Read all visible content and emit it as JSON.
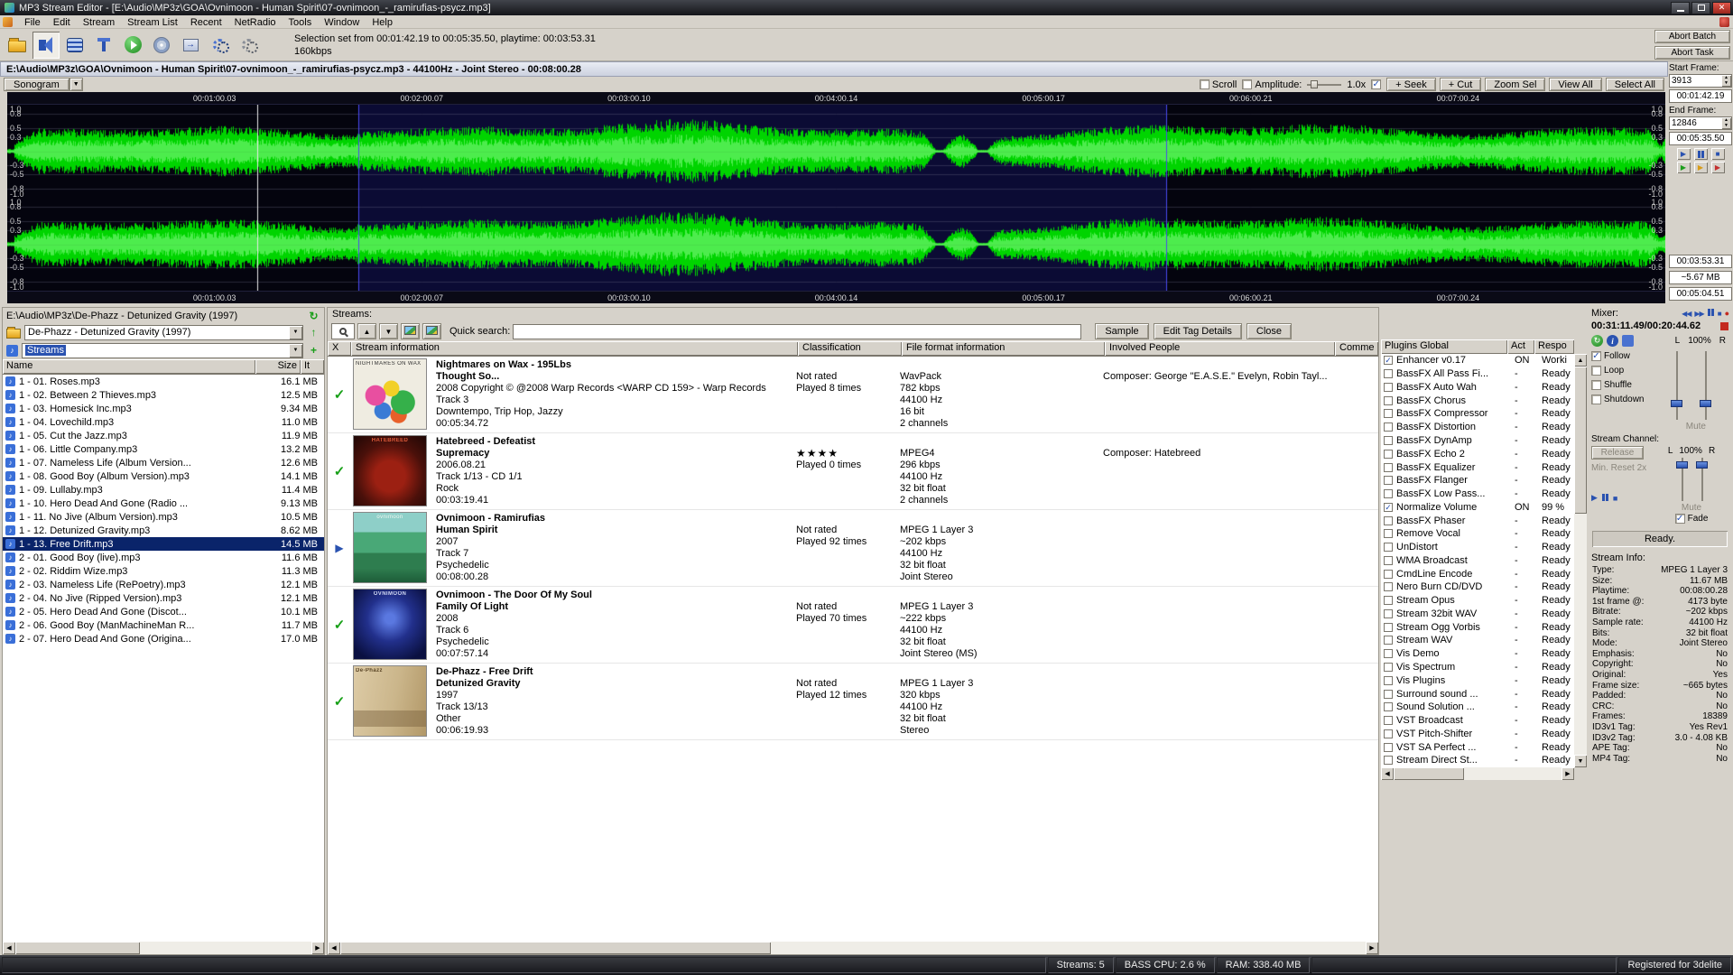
{
  "titlebar": {
    "title": "MP3 Stream Editor - [E:\\Audio\\MP3z\\GOA\\Ovnimoon - Human Spirit\\07-ovnimoon_-_ramirufias-psycz.mp3]"
  },
  "menu": {
    "items": [
      "File",
      "Edit",
      "Stream",
      "Stream List",
      "Recent",
      "NetRadio",
      "Tools",
      "Window",
      "Help"
    ]
  },
  "toolbar": {
    "icons": [
      {
        "id": "open-file"
      },
      {
        "id": "speaker",
        "pressed": true
      },
      {
        "id": "stream-stack"
      },
      {
        "id": "audio-jack"
      },
      {
        "id": "play-green"
      },
      {
        "id": "cd"
      },
      {
        "id": "encode",
        "glyph": "→"
      },
      {
        "id": "gears"
      },
      {
        "id": "settings"
      }
    ],
    "status_line1": "Selection set from 00:01:42.19 to 00:05:35.50, playtime: 00:03:53.31",
    "status_line2": "160kbps",
    "abort_batch": "Abort Batch",
    "abort_task": "Abort Task"
  },
  "wave": {
    "header": "E:\\Audio\\MP3z\\GOA\\Ovnimoon - Human Spirit\\07-ovnimoon_-_ramirufias-psycz.mp3 - 44100Hz - Joint Stereo - 00:08:00.28",
    "sonogram": "Sonogram",
    "scroll": "Scroll",
    "amplitude": "Amplitude:",
    "zoom": "1.0x",
    "buttons": [
      "+ Seek",
      "+ Cut",
      "Zoom Sel",
      "View All",
      "Select All"
    ],
    "time_markers": [
      "00:01:00.03",
      "00:02:00.07",
      "00:03:00.10",
      "00:04:00.14",
      "00:05:00.17",
      "00:06:00.21",
      "00:07:00.24"
    ],
    "amp_labels": [
      1.0,
      0.8,
      0.5,
      0.3,
      -0.3,
      -0.5,
      -0.8,
      -1.0
    ],
    "selection_start": 0.212,
    "selection_end": 0.699,
    "cursor": 0.151,
    "wave_color": "#00d400",
    "bg_color": "#04040e",
    "selection_color": "#0b0b34"
  },
  "frame_panel": {
    "start_frame_label": "Start Frame:",
    "start_frame": "3913",
    "start_time": "00:01:42.19",
    "end_frame_label": "End Frame:",
    "end_frame": "12846",
    "end_time": "00:05:35.50",
    "transport1": [
      {
        "name": "play",
        "glyph": "▶",
        "color": "#2a52b0"
      },
      {
        "name": "pause",
        "glyph": "bars",
        "color": "#2a52b0"
      },
      {
        "name": "stop",
        "glyph": "■",
        "color": "#2a52b0"
      }
    ],
    "transport2": [
      {
        "name": "play-green",
        "glyph": "▶",
        "color": "#1d9e1d"
      },
      {
        "name": "play-yellow",
        "glyph": "▶",
        "color": "#d89c18"
      },
      {
        "name": "play-red",
        "glyph": "▶",
        "color": "#c43030"
      }
    ],
    "sel_playtime": "00:03:53.31",
    "sel_size": "~5.67 MB",
    "total_time": "00:05:04.51"
  },
  "browser": {
    "path": "E:\\Audio\\MP3z\\De-Phazz - Detunized Gravity (1997)",
    "folder_combo": "De-Phazz - Detunized Gravity (1997)",
    "streams_combo": "Streams",
    "columns": [
      "Name",
      "Size",
      "It"
    ],
    "selected_index": 12,
    "files": [
      {
        "name": "1 - 01. Roses.mp3",
        "size": "16.1 MB"
      },
      {
        "name": "1 - 02. Between 2 Thieves.mp3",
        "size": "12.5 MB"
      },
      {
        "name": "1 - 03. Homesick Inc.mp3",
        "size": "9.34 MB"
      },
      {
        "name": "1 - 04. Lovechild.mp3",
        "size": "11.0 MB"
      },
      {
        "name": "1 - 05. Cut the Jazz.mp3",
        "size": "11.9 MB"
      },
      {
        "name": "1 - 06. Little Company.mp3",
        "size": "13.2 MB"
      },
      {
        "name": "1 - 07. Nameless Life (Album Version...",
        "size": "12.6 MB"
      },
      {
        "name": "1 - 08. Good Boy (Album Version).mp3",
        "size": "14.1 MB"
      },
      {
        "name": "1 - 09. Lullaby.mp3",
        "size": "11.4 MB"
      },
      {
        "name": "1 - 10. Hero Dead And Gone (Radio ...",
        "size": "9.13 MB"
      },
      {
        "name": "1 - 11. No Jive (Album Version).mp3",
        "size": "10.5 MB"
      },
      {
        "name": "1 - 12. Detunized Gravity.mp3",
        "size": "8.62 MB"
      },
      {
        "name": "1 - 13. Free Drift.mp3",
        "size": "14.5 MB"
      },
      {
        "name": "2 - 01. Good Boy (live).mp3",
        "size": "11.6 MB"
      },
      {
        "name": "2 - 02. Riddim Wize.mp3",
        "size": "11.3 MB"
      },
      {
        "name": "2 - 03. Nameless Life (RePoetry).mp3",
        "size": "12.1 MB"
      },
      {
        "name": "2 - 04. No Jive (Ripped Version).mp3",
        "size": "12.1 MB"
      },
      {
        "name": "2 - 05. Hero Dead And Gone (Discot...",
        "size": "10.1 MB"
      },
      {
        "name": "2 - 06. Good Boy (ManMachineMan R...",
        "size": "11.7 MB"
      },
      {
        "name": "2 - 07. Hero Dead And Gone (Origina...",
        "size": "17.0 MB"
      }
    ]
  },
  "streams": {
    "title": "Streams:",
    "quick_search_label": "Quick search:",
    "search_value": "",
    "buttons": [
      "Sample",
      "Edit Tag Details",
      "Close"
    ],
    "columns": [
      "X",
      "Stream information",
      "Classification",
      "File format information",
      "Involved People",
      "Comme"
    ],
    "rows": [
      {
        "status": "check",
        "art": "art-now",
        "art_label": "NIGHTMARES ON WAX",
        "title": "Nightmares on Wax - 195Lbs",
        "album": "Thought So...",
        "line3": "2008 Copyright © @2008 Warp Records <WARP CD 159> - Warp Records",
        "line4": "Track 3",
        "line5": "Downtempo, Trip Hop, Jazzy",
        "line6": "00:05:34.72",
        "rating": "Not rated",
        "played": "Played 8 times",
        "format": [
          "WavPack",
          "782 kbps",
          "44100 Hz",
          "16 bit",
          "2 channels"
        ],
        "involved": "Composer: George \"E.A.S.E.\" Evelyn, Robin Tayl..."
      },
      {
        "status": "check",
        "art": "art-hatebreed",
        "art_label": "HATEBREED",
        "title": "Hatebreed - Defeatist",
        "album": "Supremacy",
        "line3": "2006.08.21",
        "line4": "Track 1/13 - CD 1/1",
        "line5": "Rock",
        "line6": "00:03:19.41",
        "rating": "★★★★",
        "played": "Played 0 times",
        "format": [
          "MPEG4",
          "296 kbps",
          "44100 Hz",
          "32 bit float",
          "2 channels"
        ],
        "involved": "Composer: Hatebreed"
      },
      {
        "status": "play",
        "art": "art-ovnimoon1",
        "art_label": "ovnimoon",
        "title": "Ovnimoon - Ramirufias",
        "album": "Human Spirit",
        "line3": "2007",
        "line4": "Track 7",
        "line5": "Psychedelic",
        "line6": "00:08:00.28",
        "rating": "Not rated",
        "played": "Played 92 times",
        "format": [
          "MPEG 1 Layer 3",
          "~202 kbps",
          "44100 Hz",
          "32 bit float",
          "Joint Stereo"
        ],
        "involved": ""
      },
      {
        "status": "check",
        "art": "art-ovnimoon2",
        "art_label": "OVNIMOON",
        "title": "Ovnimoon - The Door Of My Soul",
        "album": "Family Of Light",
        "line3": "2008",
        "line4": "Track 6",
        "line5": "Psychedelic",
        "line6": "00:07:57.14",
        "rating": "Not rated",
        "played": "Played 70 times",
        "format": [
          "MPEG 1 Layer 3",
          "~222 kbps",
          "44100 Hz",
          "32 bit float",
          "Joint Stereo (MS)"
        ],
        "involved": ""
      },
      {
        "status": "check",
        "art": "art-dephazz",
        "art_label": "De-Phazz",
        "title": "De-Phazz - Free Drift",
        "album": "Detunized Gravity",
        "line3": "1997",
        "line4": "Track 13/13",
        "line5": "Other",
        "line6": "00:06:19.93",
        "rating": "Not rated",
        "played": "Played 12 times",
        "format": [
          "MPEG 1 Layer 3",
          "320 kbps",
          "44100 Hz",
          "32 bit float",
          "Stereo"
        ],
        "involved": ""
      }
    ]
  },
  "plugins": {
    "columns": [
      "Plugins Global",
      "Act",
      "Respo"
    ],
    "rows": [
      {
        "name": "Enhancer v0.17",
        "act": "ON",
        "resp": "Worki",
        "checked": true
      },
      {
        "name": "BassFX All Pass Fi...",
        "act": "-",
        "resp": "Ready",
        "checked": false
      },
      {
        "name": "BassFX Auto Wah",
        "act": "-",
        "resp": "Ready",
        "checked": false
      },
      {
        "name": "BassFX Chorus",
        "act": "-",
        "resp": "Ready",
        "checked": false
      },
      {
        "name": "BassFX Compressor",
        "act": "-",
        "resp": "Ready",
        "checked": false
      },
      {
        "name": "BassFX Distortion",
        "act": "-",
        "resp": "Ready",
        "checked": false
      },
      {
        "name": "BassFX DynAmp",
        "act": "-",
        "resp": "Ready",
        "checked": false
      },
      {
        "name": "BassFX Echo 2",
        "act": "-",
        "resp": "Ready",
        "checked": false
      },
      {
        "name": "BassFX Equalizer",
        "act": "-",
        "resp": "Ready",
        "checked": false
      },
      {
        "name": "BassFX Flanger",
        "act": "-",
        "resp": "Ready",
        "checked": false
      },
      {
        "name": "BassFX Low Pass...",
        "act": "-",
        "resp": "Ready",
        "checked": false
      },
      {
        "name": "Normalize Volume",
        "act": "ON",
        "resp": "99 %",
        "checked": true
      },
      {
        "name": "BassFX Phaser",
        "act": "-",
        "resp": "Ready",
        "checked": false
      },
      {
        "name": "Remove Vocal",
        "act": "-",
        "resp": "Ready",
        "checked": false
      },
      {
        "name": "UnDistort",
        "act": "-",
        "resp": "Ready",
        "checked": false
      },
      {
        "name": "WMA Broadcast",
        "act": "-",
        "resp": "Ready",
        "checked": false
      },
      {
        "name": "CmdLine Encode",
        "act": "-",
        "resp": "Ready",
        "checked": false
      },
      {
        "name": "Nero Burn CD/DVD",
        "act": "-",
        "resp": "Ready",
        "checked": false
      },
      {
        "name": "Stream Opus",
        "act": "-",
        "resp": "Ready",
        "checked": false
      },
      {
        "name": "Stream 32bit WAV",
        "act": "-",
        "resp": "Ready",
        "checked": false
      },
      {
        "name": "Stream Ogg Vorbis",
        "act": "-",
        "resp": "Ready",
        "checked": false
      },
      {
        "name": "Stream WAV",
        "act": "-",
        "resp": "Ready",
        "checked": false
      },
      {
        "name": "Vis Demo",
        "act": "-",
        "resp": "Ready",
        "checked": false
      },
      {
        "name": "Vis Spectrum",
        "act": "-",
        "resp": "Ready",
        "checked": false
      },
      {
        "name": "Vis Plugins",
        "act": "-",
        "resp": "Ready",
        "checked": false
      },
      {
        "name": "Surround sound ...",
        "act": "-",
        "resp": "Ready",
        "checked": false
      },
      {
        "name": "Sound Solution ...",
        "act": "-",
        "resp": "Ready",
        "checked": false
      },
      {
        "name": "VST Broadcast",
        "act": "-",
        "resp": "Ready",
        "checked": false
      },
      {
        "name": "VST Pitch-Shifter",
        "act": "-",
        "resp": "Ready",
        "checked": false
      },
      {
        "name": "VST SA Perfect ...",
        "act": "-",
        "resp": "Ready",
        "checked": false
      },
      {
        "name": "Stream Direct St...",
        "act": "-",
        "resp": "Ready",
        "checked": false
      }
    ]
  },
  "mixer": {
    "title": "Mixer:",
    "transport": [
      {
        "name": "previous",
        "glyph": "◀◀",
        "rec": false
      },
      {
        "name": "next",
        "glyph": "▶▶",
        "rec": false
      },
      {
        "name": "pause",
        "glyph": "bars",
        "rec": false
      },
      {
        "name": "stop",
        "glyph": "■",
        "rec": false
      },
      {
        "name": "record",
        "glyph": "●",
        "rec": true
      }
    ],
    "time": "00:31:11.49/00:20:44.62",
    "left_label": "L",
    "volume": "100%",
    "right_label": "R",
    "checkboxes": [
      {
        "label": "Follow",
        "checked": true
      },
      {
        "label": "Loop",
        "checked": false
      },
      {
        "label": "Shuffle",
        "checked": false
      },
      {
        "label": "Shutdown",
        "checked": false
      }
    ],
    "mute_label": "Mute",
    "stream_channel_label": "Stream Channel:",
    "release_button": "Release",
    "min_reset": "Min. Reset 2x",
    "channel_l": "L",
    "channel_volume": "100%",
    "channel_r": "R",
    "channel_mute": "Mute",
    "fade_label": "Fade",
    "fade_checked": true,
    "ready": "Ready.",
    "stream_info_label": "Stream Info:",
    "info": [
      {
        "k": "Type:",
        "v": "MPEG 1 Layer 3"
      },
      {
        "k": "Size:",
        "v": "11.67 MB"
      },
      {
        "k": "Playtime:",
        "v": "00:08:00.28"
      },
      {
        "k": "1st frame @:",
        "v": "4173 byte"
      },
      {
        "k": "Bitrate:",
        "v": "~202 kbps"
      },
      {
        "k": "Sample rate:",
        "v": "44100 Hz"
      },
      {
        "k": "Bits:",
        "v": "32 bit float"
      },
      {
        "k": "Mode:",
        "v": "Joint Stereo"
      },
      {
        "k": "Emphasis:",
        "v": "No"
      },
      {
        "k": "Copyright:",
        "v": "No"
      },
      {
        "k": "Original:",
        "v": "Yes"
      },
      {
        "k": "Frame size:",
        "v": "~665 bytes"
      },
      {
        "k": "Padded:",
        "v": "No"
      },
      {
        "k": "CRC:",
        "v": "No"
      },
      {
        "k": "Frames:",
        "v": "18389"
      },
      {
        "k": "ID3v1 Tag:",
        "v": "Yes Rev1"
      },
      {
        "k": "ID3v2 Tag:",
        "v": "3.0 - 4.08 KB"
      },
      {
        "k": "APE Tag:",
        "v": "No"
      },
      {
        "k": "MP4 Tag:",
        "v": "No"
      }
    ]
  },
  "statusbar": {
    "streams": "Streams: 5",
    "cpu": "BASS CPU: 2.6 %",
    "ram": "RAM: 338.40 MB",
    "registered": "Registered for 3delite"
  }
}
